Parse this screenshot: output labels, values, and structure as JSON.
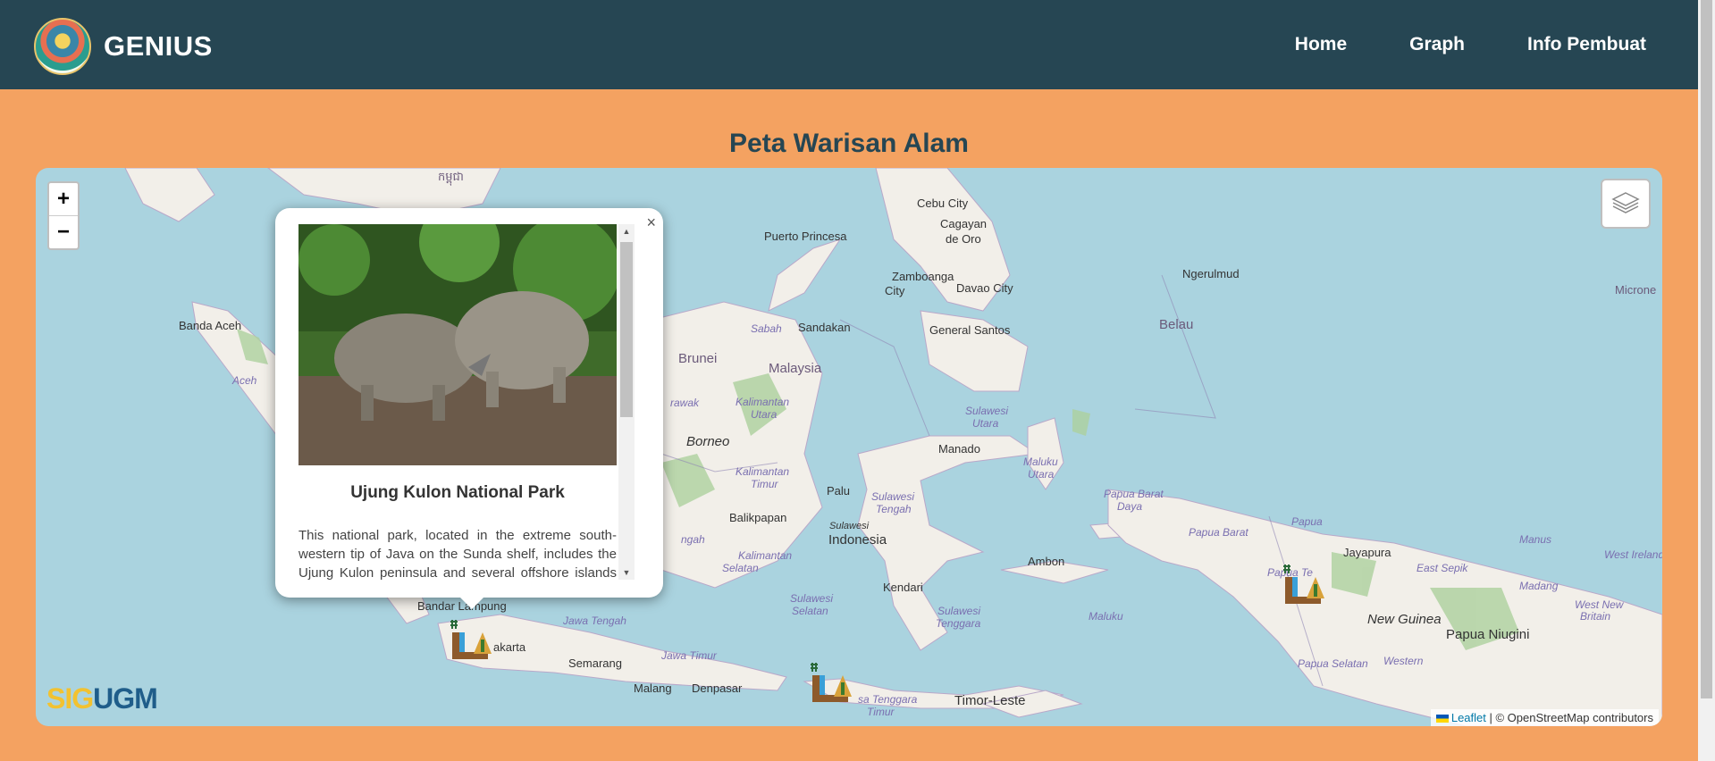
{
  "header": {
    "brand": "GENIUS",
    "nav": [
      {
        "label": "Home"
      },
      {
        "label": "Graph"
      },
      {
        "label": "Info Pembuat"
      }
    ]
  },
  "page": {
    "title": "Peta Warisan Alam"
  },
  "map": {
    "zoom_in": "+",
    "zoom_out": "−",
    "attribution_link": "Leaflet",
    "attribution_text": " | © OpenStreetMap contributors",
    "logo_sig": "SIG",
    "logo_ugm": "UGM",
    "labels": {
      "cebu": "Cebu City",
      "cagayan": "Cagayan",
      "deoro": "de Oro",
      "puerto": "Puerto Princesa",
      "zamboanga": "Zamboanga",
      "zcity": "City",
      "davao": "Davao City",
      "ngerulmud": "Ngerulmud",
      "bandaaceh": "Banda Aceh",
      "aceh": "Aceh",
      "sandakan": "Sandakan",
      "gensantos": "General Santos",
      "sabah": "Sabah",
      "brunei": "Brunei",
      "malaysia": "Malaysia",
      "belau": "Belau",
      "sulawesiutara": "Sulawesi",
      "sulawesiutara2": "Utara",
      "kalimantanutara": "Kalimantan",
      "kalimantanutara2": "Utara",
      "borneo": "Borneo",
      "manado": "Manado",
      "malukuutara": "Maluku",
      "malukuutara2": "Utara",
      "kalimantantimur": "Kalimantan",
      "kalimantantimur2": "Timur",
      "palu": "Palu",
      "sulawesitengah": "Sulawesi",
      "sulawesitengah2": "Tengah",
      "papuabarat": "Papua Barat",
      "papuabarat2": "Daya",
      "balikpapan": "Balikpapan",
      "sulawesi": "Sulawesi",
      "indonesia": "Indonesia",
      "papuabarat3": "Papua Barat",
      "papua": "Papua",
      "jayapura": "Jayapura",
      "manus": "Manus",
      "newireland": "West Ireland",
      "ambon": "Ambon",
      "kendari": "Kendari",
      "papuate": "Papua Te",
      "eastsepik": "East Sepik",
      "madang": "Madang",
      "westnewbritain": "West New",
      "westnewbritain2": "Britain",
      "newguinea": "New Guinea",
      "papuaniugini": "Papua Niugini",
      "bandarlampung": "Bandar Lampung",
      "jawatengah": "Jawa Tengah",
      "kalimantanselatan": "Kalimantan",
      "kalimantanselatan2": "Selatan",
      "sulawesiselatan": "Sulawesi",
      "sulawesiselatan2": "Selatan",
      "sulawesitenggara": "Sulawesi",
      "sulawesitenggara2": "Tenggara",
      "maluku": "Maluku",
      "jakarta": "akarta",
      "semarang": "Semarang",
      "jawatimur": "Jawa Timur",
      "papuaselatan": "Papua Selatan",
      "western": "Western",
      "malang": "Malang",
      "denpasar": "Denpasar",
      "nusatenggara": "sa Tenggara",
      "nusatimur": "Timur",
      "timorleste": "Timor-Leste",
      "micronesia": "Microne",
      "cambodia": "កម្ពុជា",
      "kalbarat": "rawak",
      "tengah": "ngah"
    }
  },
  "popup": {
    "close": "×",
    "title": "Ujung Kulon National Park",
    "description": "This national park, located in the extreme south-western tip of Java on the Sunda shelf, includes the Ujung Kulon peninsula and several offshore islands and encompasses the natural reserve of Krakatoa."
  },
  "colors": {
    "header_bg": "#264653",
    "page_bg": "#f4a261",
    "sea": "#aad3df",
    "land": "#f2efe9"
  }
}
